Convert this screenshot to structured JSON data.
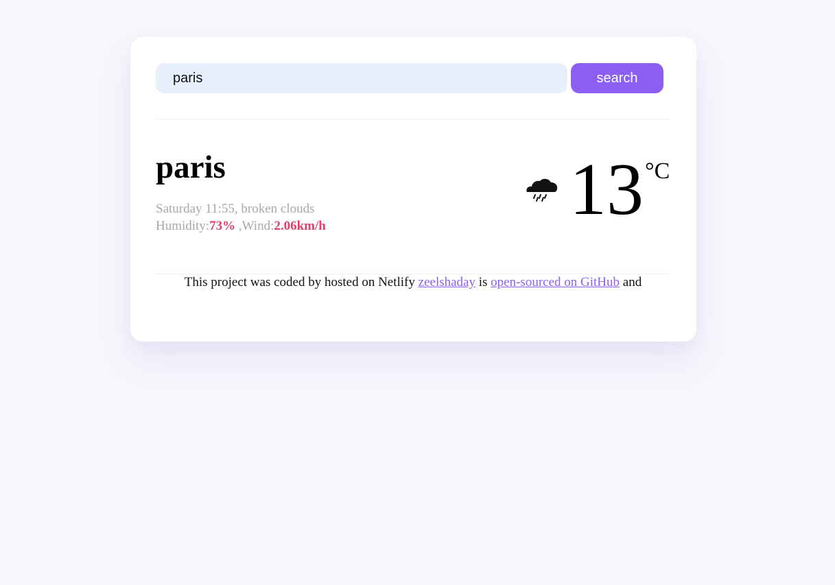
{
  "search": {
    "value": "paris",
    "button_label": "search"
  },
  "weather": {
    "city": "paris",
    "day_time": "Saturday 11:55",
    "separator": ",",
    "description": "broken clouds",
    "humidity_label": "Humidity:",
    "humidity_value": "73%",
    "wind_label": " ,Wind:",
    "wind_value": "2.06km/h",
    "icon": "rain-cloud-icon",
    "temperature": "13",
    "unit": "°C"
  },
  "footer": {
    "prefix": "This project was coded by hosted on Netlify",
    "author_link": "zeelshaday",
    "middle": "is",
    "github_link": "open-sourced on GitHub",
    "suffix": "and"
  },
  "colors": {
    "accent": "#8c5ff2",
    "highlight": "#e23f6c",
    "input_background": "#e8effd",
    "page_background": "#f7f6fc"
  }
}
